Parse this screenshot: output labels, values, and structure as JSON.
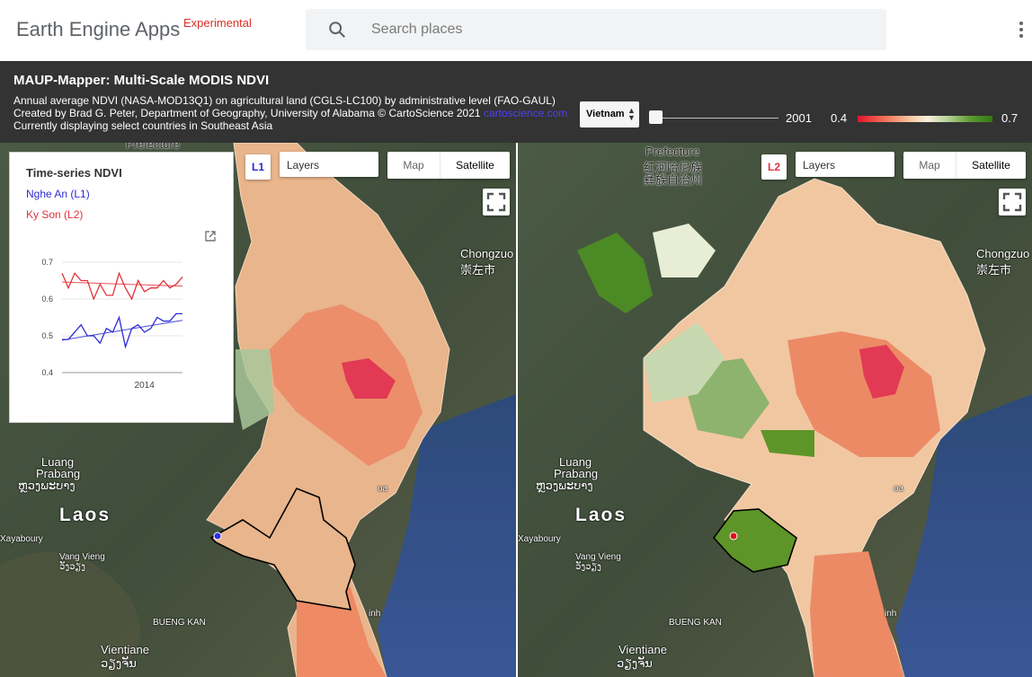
{
  "app": {
    "title": "Earth Engine Apps",
    "tag": "Experimental"
  },
  "search": {
    "placeholder": "Search places"
  },
  "icons": {
    "search": "search-icon",
    "menu": "more-vert-icon",
    "fullscreen": "fullscreen-icon",
    "popout": "open-in-new-icon"
  },
  "panel": {
    "title": "MAUP-Mapper: Multi-Scale MODIS NDVI",
    "line1": "Annual average NDVI (NASA-MOD13Q1) on agricultural land (CGLS-LC100) by administrative level (FAO-GAUL)",
    "line2": "Created by Brad G. Peter, Department of Geography, University of Alabama © CartoScience 2021",
    "link": "cartoscience.com",
    "line3": "Currently displaying select countries in Southeast Asia",
    "country": "Vietnam",
    "year": "2001",
    "year_slider": {
      "min": 2001,
      "value": 2001
    },
    "legend": {
      "min": "0.4",
      "max": "0.7",
      "colors": [
        "#e3122f",
        "#f07a5a",
        "#f5c9a7",
        "#f5f0dc",
        "#b9d39a",
        "#5c9a31",
        "#2f7a10"
      ]
    }
  },
  "maps": {
    "left": {
      "tag": "L1",
      "tag_color": "#2b2bd6",
      "layers": "Layers",
      "map_btn": "Map",
      "sat_btn": "Satellite"
    },
    "right": {
      "tag": "L2",
      "tag_color": "#e2323a",
      "layers": "Layers",
      "map_btn": "Map",
      "sat_btn": "Satellite"
    },
    "labels": {
      "prefecture": "Prefecture",
      "honghe": "红河哈尼族",
      "yizu": "彝族自治州",
      "chongzuo": "Chongzuo",
      "chongzuo_cn": "崇左市",
      "luang": "Luang",
      "prabang": "Prabang",
      "luang_lao": "ຫຼວງພະບາງ",
      "laos": "Laos",
      "xayaboury": "Xayaboury",
      "vang_vieng": "Vang Vieng",
      "vang_vieng_lao": "ວັງວຽງ",
      "bueng_kan": "BUENG KAN",
      "vientiane": "Vientiane",
      "vientiane_lao": "ວຽງຈັນ",
      "ha": "oa",
      "vinh": "inh"
    }
  },
  "chart_data": {
    "type": "line",
    "title": "Time-series NDVI",
    "xlabel": "",
    "ylabel": "",
    "ylim": [
      0.4,
      0.7
    ],
    "yticks": [
      "0.7",
      "0.6",
      "0.5",
      "0.4"
    ],
    "xticks": [
      "2014"
    ],
    "x": [
      2001,
      2002,
      2003,
      2004,
      2005,
      2006,
      2007,
      2008,
      2009,
      2010,
      2011,
      2012,
      2013,
      2014,
      2015,
      2016,
      2017,
      2018,
      2019,
      2020
    ],
    "series": [
      {
        "name": "Nghe An (L1)",
        "color": "#2b2bd6",
        "values": [
          0.49,
          0.49,
          0.51,
          0.53,
          0.5,
          0.5,
          0.48,
          0.52,
          0.51,
          0.55,
          0.47,
          0.52,
          0.53,
          0.51,
          0.52,
          0.55,
          0.54,
          0.54,
          0.56,
          0.56
        ],
        "trend": [
          0.488,
          0.542
        ]
      },
      {
        "name": "Ky Son (L2)",
        "color": "#e2323a",
        "values": [
          0.67,
          0.63,
          0.67,
          0.65,
          0.65,
          0.6,
          0.64,
          0.61,
          0.61,
          0.67,
          0.63,
          0.6,
          0.65,
          0.62,
          0.63,
          0.63,
          0.65,
          0.63,
          0.64,
          0.66
        ],
        "trend": [
          0.646,
          0.635
        ]
      }
    ]
  }
}
